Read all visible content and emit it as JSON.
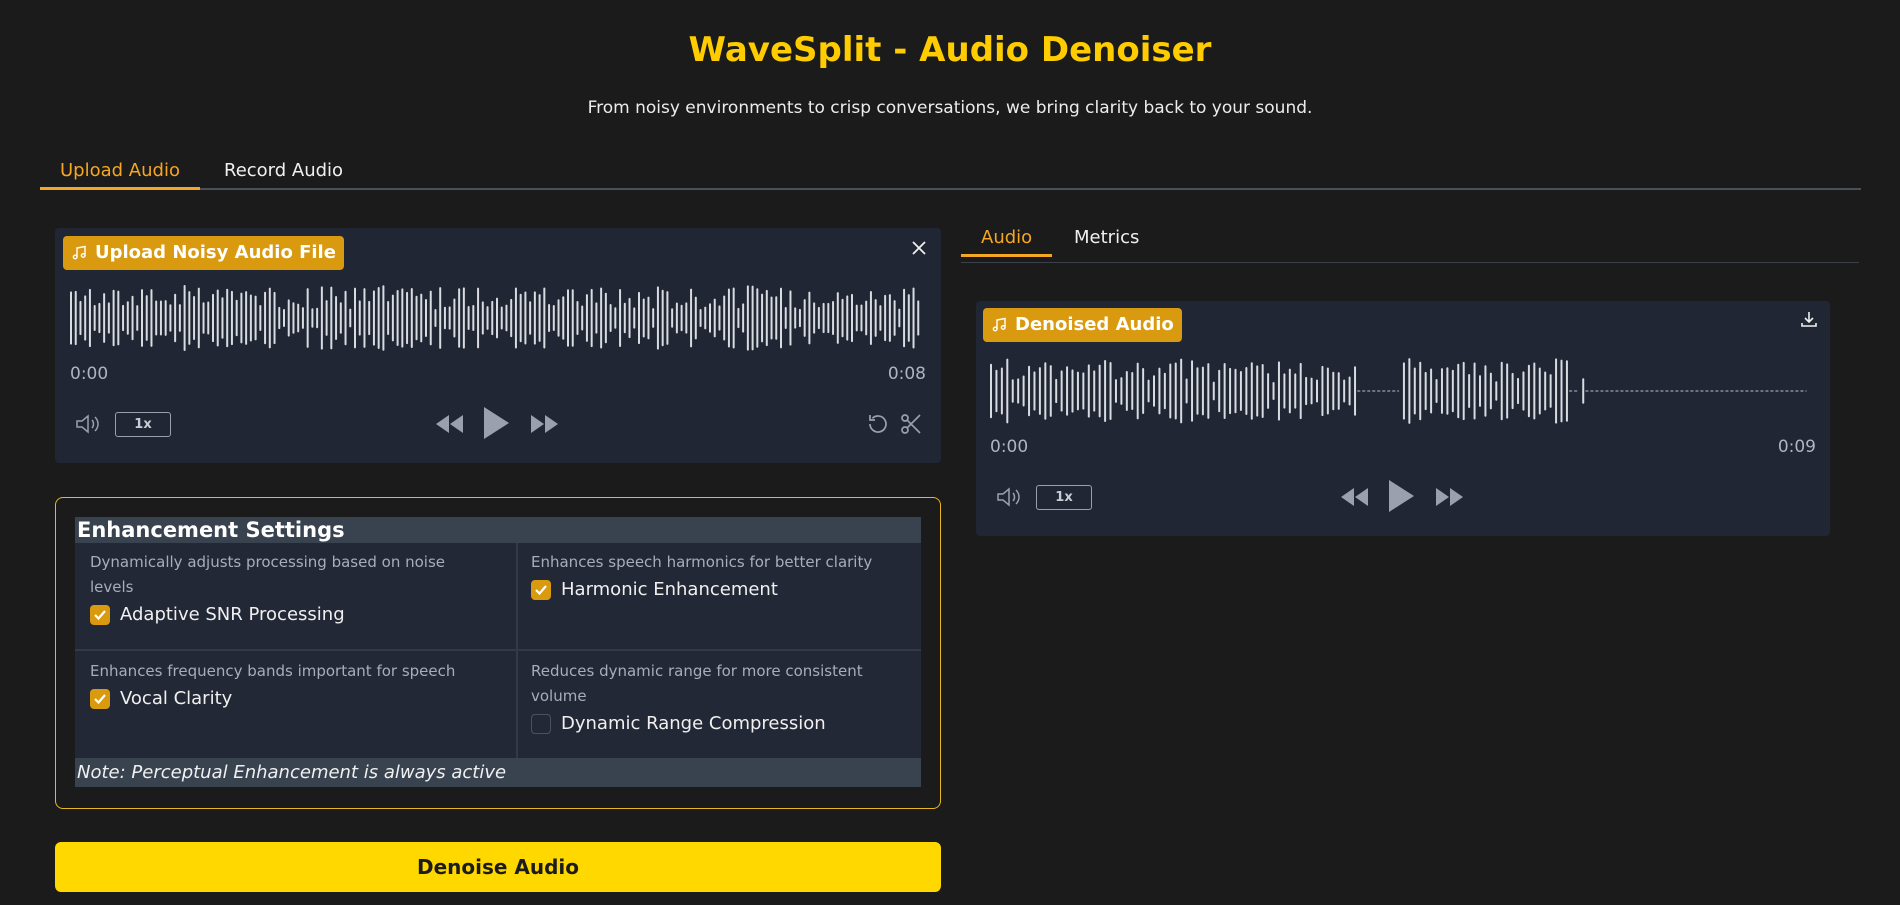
{
  "app": {
    "title": "WaveSplit - Audio Denoiser",
    "subtitle": "From noisy environments to crisp conversations, we bring clarity back to your sound."
  },
  "main_tabs": [
    {
      "label": "Upload Audio",
      "active": true
    },
    {
      "label": "Record Audio",
      "active": false
    }
  ],
  "input_audio": {
    "badge_label": "Upload Noisy Audio File",
    "time_start": "0:00",
    "time_end": "0:08",
    "speed": "1x"
  },
  "settings": {
    "heading": "Enhancement Settings",
    "options": [
      {
        "description": "Dynamically adjusts processing based on noise levels",
        "label": "Adaptive SNR Processing",
        "checked": true
      },
      {
        "description": "Enhances speech harmonics for better clarity",
        "label": "Harmonic Enhancement",
        "checked": true
      },
      {
        "description": "Enhances frequency bands important for speech",
        "label": "Vocal Clarity",
        "checked": true
      },
      {
        "description": "Reduces dynamic range for more consistent volume",
        "label": "Dynamic Range Compression",
        "checked": false
      }
    ],
    "note": "Note: Perceptual Enhancement is always active"
  },
  "denoise_button": "Denoise Audio",
  "result_tabs": [
    {
      "label": "Audio",
      "active": true
    },
    {
      "label": "Metrics",
      "active": false
    }
  ],
  "output_audio": {
    "badge_label": "Denoised Audio",
    "time_start": "0:00",
    "time_end": "0:09",
    "speed": "1x"
  },
  "colors": {
    "accent": "#ffcc00",
    "tab_active": "#f5a623",
    "badge": "#d99a0f",
    "button": "#ffd800",
    "panel": "#202633"
  }
}
